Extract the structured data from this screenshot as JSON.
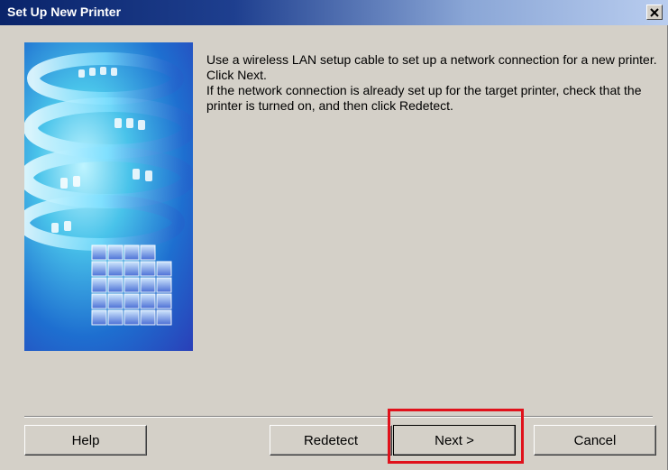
{
  "window": {
    "title": "Set Up New Printer",
    "close_symbol": "✕"
  },
  "message": {
    "line1": "Use a wireless LAN setup cable to set up a network connection for a new printer. Click Next.",
    "line2": "If the network connection is already set up for the target printer, check that the printer is turned on, and then click Redetect."
  },
  "buttons": {
    "help": "Help",
    "redetect": "Redetect",
    "next": "Next >",
    "cancel": "Cancel"
  },
  "icons": {
    "close": "close-icon",
    "illustration": "network-spiral-illustration"
  },
  "colors": {
    "titlebar_start": "#0a246a",
    "titlebar_end": "#b9cdef",
    "dialog_bg": "#d4d0c8",
    "highlight": "#e0111b"
  }
}
